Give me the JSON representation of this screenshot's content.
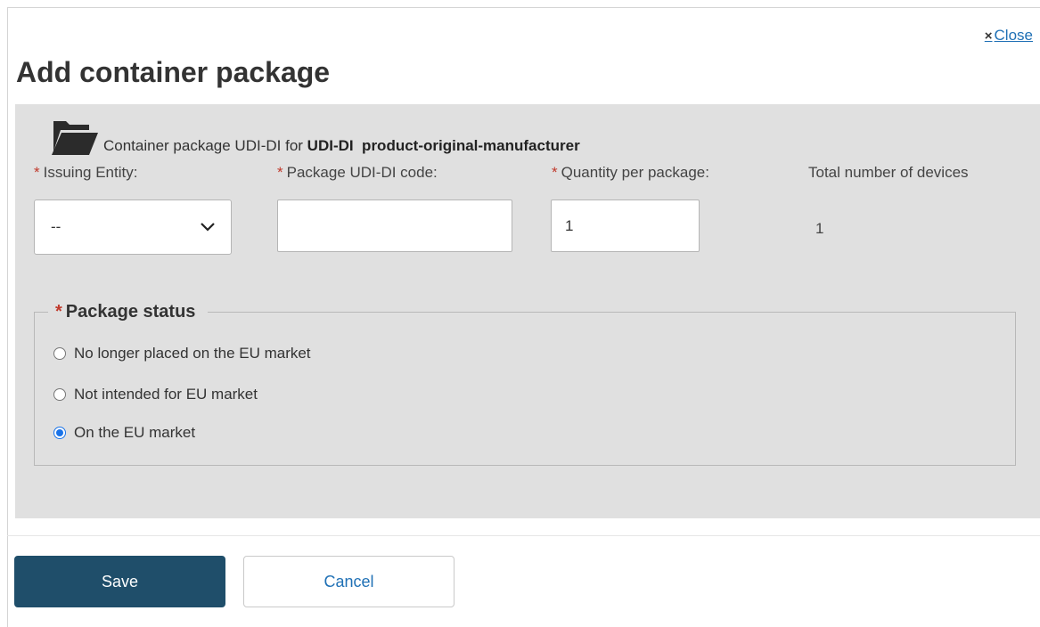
{
  "dialog": {
    "title": "Add container package",
    "close_label": "Close",
    "close_glyph": "×"
  },
  "package": {
    "caption_prefix": "Container package UDI-DI for",
    "caption_bold": "UDI-DI  product-original-manufacturer",
    "icon": "folder-open-icon"
  },
  "fields": {
    "required_marker": "*",
    "issuing_entity": {
      "label": "Issuing Entity:",
      "value": "--"
    },
    "udi_code": {
      "label": "Package UDI-DI code:",
      "value": ""
    },
    "quantity": {
      "label": "Quantity per package:",
      "value": "1"
    },
    "total": {
      "label": "Total number of devices",
      "value": "1"
    }
  },
  "status": {
    "legend": "Package status",
    "options": [
      {
        "label": "No longer placed on the EU market",
        "checked": false
      },
      {
        "label": "Not intended for EU market",
        "checked": false
      },
      {
        "label": "On the EU market",
        "checked": true
      }
    ]
  },
  "actions": {
    "save_label": "Save",
    "cancel_label": "Cancel"
  },
  "colors": {
    "panel_bg": "#e0e0e0",
    "primary": "#1f4e6a",
    "link": "#1f70b5",
    "required": "#c0392b",
    "radio_checked": "#1a73e8"
  }
}
